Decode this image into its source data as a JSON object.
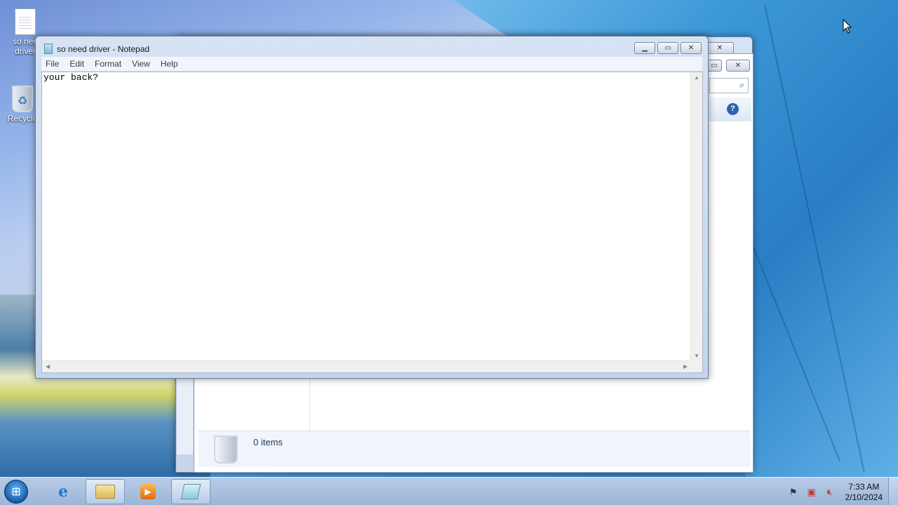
{
  "desktop": {
    "icons": [
      {
        "label": "so need driver",
        "visible_label": "so nee\ndriver",
        "icon": "text-document-icon"
      },
      {
        "label": "Recycle Bin",
        "visible_label": "Recycle",
        "icon": "recycle-bin-icon"
      }
    ]
  },
  "notepad": {
    "title": "so need driver - Notepad",
    "menu": [
      "File",
      "Edit",
      "Format",
      "View",
      "Help"
    ],
    "content": "your back?",
    "controls": {
      "minimize": "minimize-icon",
      "maximize": "maximize-icon",
      "close": "close-icon"
    }
  },
  "explorer": {
    "status_text": "0 items",
    "help_icon": "?",
    "search_icon": "search-icon"
  },
  "taskbar": {
    "apps": [
      {
        "name": "Internet Explorer",
        "icon": "ie-icon"
      },
      {
        "name": "Windows Explorer",
        "icon": "folder-icon"
      },
      {
        "name": "Windows Media Player",
        "icon": "media-player-icon"
      },
      {
        "name": "Notepad",
        "icon": "notepad-icon",
        "active": true
      }
    ],
    "clock_time": "7:33 AM",
    "clock_date": "2/10/2024",
    "tray_icons": [
      "flag-icon",
      "network-icon",
      "volume-muted-icon"
    ]
  }
}
